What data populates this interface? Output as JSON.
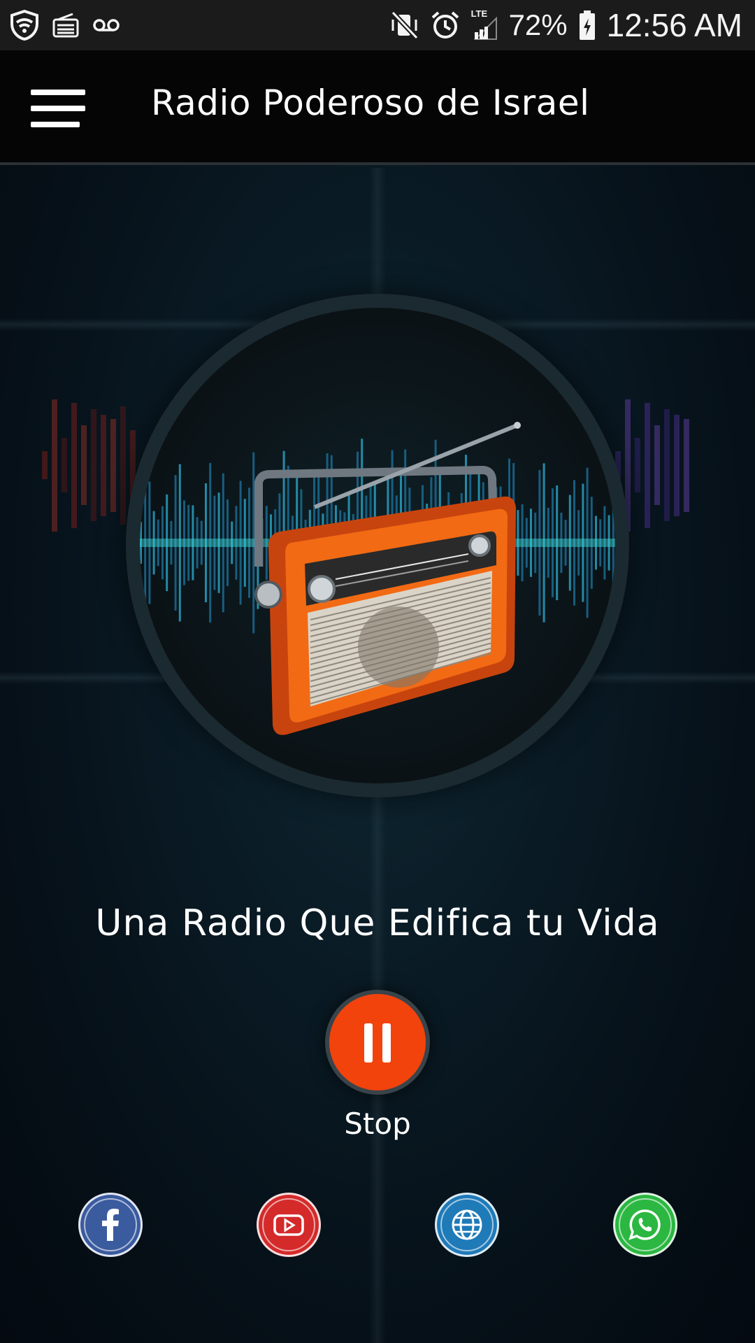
{
  "status_bar": {
    "battery": "72%",
    "time": "12:56 AM",
    "network": "LTE",
    "icons_left": [
      "shield-icon",
      "radio-icon",
      "voicemail-icon"
    ],
    "icons_right": [
      "vibrate-mute-icon",
      "alarm-icon",
      "signal-icon",
      "battery-charging-icon"
    ]
  },
  "app_bar": {
    "title": "Radio Poderoso de Israel",
    "menu_icon": "hamburger-menu-icon"
  },
  "player": {
    "artwork": "radio-artwork",
    "tagline": "Una Radio Que Edifica tu Vida",
    "state": "playing",
    "control_icon": "pause-icon",
    "control_label": "Stop",
    "accent_color": "#f2430d"
  },
  "social": [
    {
      "name": "facebook",
      "icon": "facebook-icon",
      "color": "#3b5b9f"
    },
    {
      "name": "youtube",
      "icon": "youtube-icon",
      "color": "#d42a2a"
    },
    {
      "name": "website",
      "icon": "globe-icon",
      "color": "#1f7ab8"
    },
    {
      "name": "whatsapp",
      "icon": "whatsapp-icon",
      "color": "#2bb741"
    }
  ]
}
